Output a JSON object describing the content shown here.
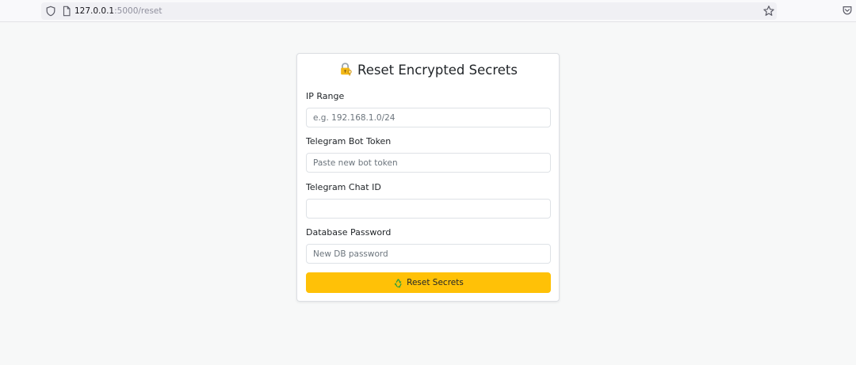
{
  "browser": {
    "url_host": "127.0.0.1",
    "url_path": ":5000/reset",
    "icons": [
      "shield-icon",
      "page-icon",
      "bookmark-star-icon",
      "pocket-icon"
    ]
  },
  "form": {
    "title": "Reset Encrypted Secrets",
    "title_icon": "lock-with-key-icon",
    "fields": [
      {
        "label": "IP Range",
        "placeholder": "e.g. 192.168.1.0/24",
        "value": ""
      },
      {
        "label": "Telegram Bot Token",
        "placeholder": "Paste new bot token",
        "value": ""
      },
      {
        "label": "Telegram Chat ID",
        "placeholder": "",
        "value": ""
      },
      {
        "label": "Database Password",
        "placeholder": "New DB password",
        "value": ""
      }
    ],
    "submit_label": "Reset Secrets",
    "submit_icon": "recycle-icon"
  },
  "colors": {
    "page_background": "#f7f8f8",
    "button_accent": "#ffc107",
    "text": "#212529",
    "placeholder": "#6c757d"
  }
}
